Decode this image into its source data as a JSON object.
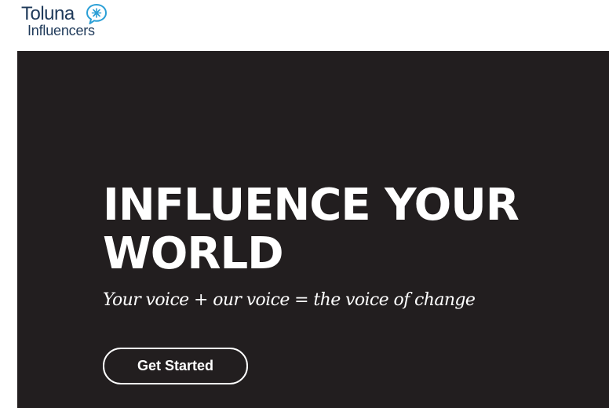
{
  "brand": {
    "line1": "Toluna",
    "line2": "Influencers",
    "logo_icon": "speech-bubble-spark-icon",
    "color": "#1f3a5a",
    "accent": "#2a9fd6"
  },
  "hero": {
    "background": "#221e1f",
    "headline": "INFLUENCE YOUR WORLD",
    "tagline": "Your voice + our voice = the voice of change",
    "cta_label": "Get Started"
  }
}
